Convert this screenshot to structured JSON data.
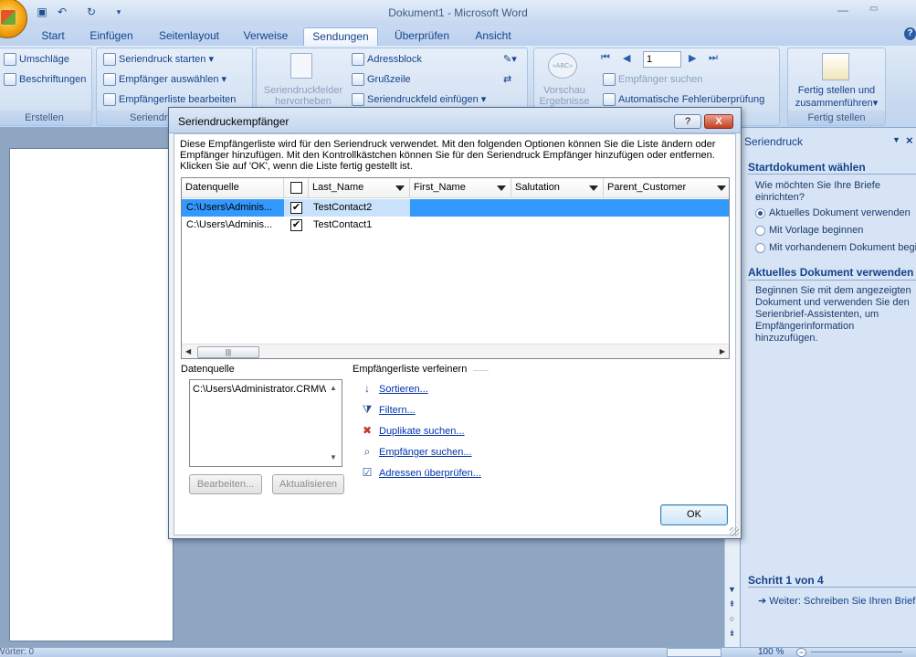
{
  "window": {
    "title": "Dokument1 - Microsoft Word"
  },
  "tabs": [
    "Start",
    "Einfügen",
    "Seitenlayout",
    "Verweise",
    "Sendungen",
    "Überprüfen",
    "Ansicht"
  ],
  "active_tab": "Sendungen",
  "ribbon": {
    "erstellen": {
      "label": "Erstellen",
      "umschlaege": "Umschläge",
      "beschriftungen": "Beschriftungen"
    },
    "seriendruck_starten": {
      "label": "Seriendr",
      "start": "Seriendruck starten",
      "empfaenger_auswaehlen": "Empfänger auswählen",
      "empfaengerliste": "Empfängerliste bearbeiten"
    },
    "felder": {
      "hervorheben_line1": "Seriendruckfelder",
      "hervorheben_line2": "hervorheben",
      "adressblock": "Adressblock",
      "grusszeile": "Grußzeile",
      "feld_einfuegen": "Seriendruckfeld einfügen"
    },
    "vorschau": {
      "line1": "Vorschau",
      "line2": "Ergebnisse",
      "record_number": "1",
      "empfaenger_suchen": "Empfänger suchen",
      "fehlerpruefung": "Automatische Fehlerüberprüfung"
    },
    "fertig": {
      "label": "Fertig stellen",
      "button_line1": "Fertig stellen und",
      "button_line2": "zusammenführen"
    }
  },
  "taskpane": {
    "title": "Seriendruck",
    "heading1": "Startdokument wählen",
    "question": "Wie möchten Sie Ihre Briefe einrichten?",
    "options": [
      "Aktuelles Dokument verwenden",
      "Mit Vorlage beginnen",
      "Mit vorhandenem Dokument beginnen"
    ],
    "selected_option": 0,
    "heading2": "Aktuelles Dokument verwenden",
    "description": "Beginnen Sie mit dem angezeigten Dokument und verwenden Sie den Serienbrief-Assistenten, um Empfängerinformation hinzuzufügen.",
    "step": "Schritt 1 von 4",
    "next_link": "Weiter: Schreiben Sie Ihren Brief"
  },
  "statusbar": {
    "words": "Wörter: 0",
    "zoom": "100 %"
  },
  "dialog": {
    "title": "Seriendruckempfänger",
    "help": "?",
    "close": "X",
    "description": "Diese Empfängerliste wird für den Seriendruck verwendet. Mit den folgenden Optionen können Sie die Liste ändern oder Empfänger hinzufügen. Mit den Kontrollkästchen können Sie für den Seriendruck Empfänger hinzufügen oder entfernen. Klicken Sie auf 'OK', wenn die Liste fertig gestellt ist.",
    "columns": [
      "Datenquelle",
      "",
      "Last_Name",
      "First_Name",
      "Salutation",
      "Parent_Customer"
    ],
    "rows": [
      {
        "source": "C:\\Users\\Adminis...",
        "checked": "✔",
        "last_name": "TestContact2",
        "first_name": "",
        "salutation": "",
        "parent": ""
      },
      {
        "source": "C:\\Users\\Adminis...",
        "checked": "✔",
        "last_name": "TestContact1",
        "first_name": "",
        "salutation": "",
        "parent": ""
      }
    ],
    "selected_row": 0,
    "datasource_label": "Datenquelle",
    "datasource_item": "C:\\Users\\Administrator.CRMW(",
    "refine_label": "Empfängerliste verfeinern",
    "links": [
      "Sortieren...",
      "Filtern...",
      "Duplikate suchen...",
      "Empfänger suchen...",
      "Adressen überprüfen..."
    ],
    "btn_edit": "Bearbeiten...",
    "btn_refresh": "Aktualisieren",
    "btn_ok": "OK"
  }
}
